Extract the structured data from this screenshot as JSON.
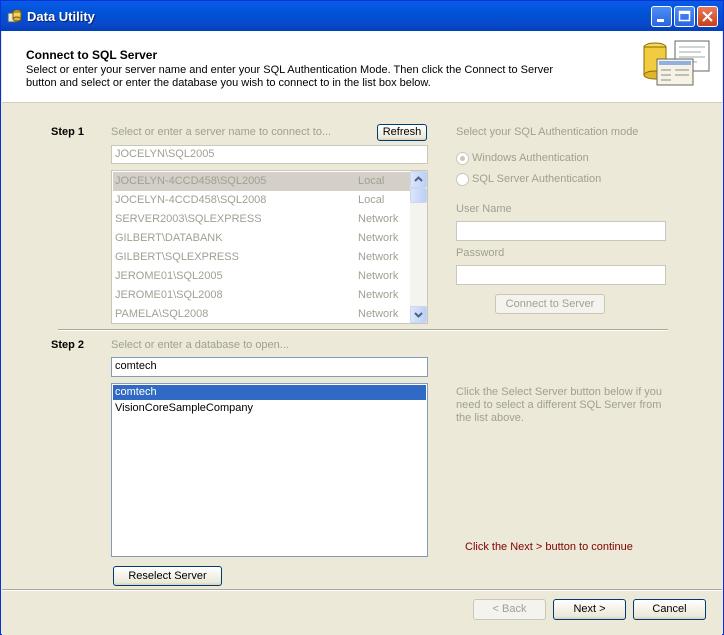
{
  "window": {
    "title": "Data Utility"
  },
  "header": {
    "title": "Connect to SQL Server",
    "description": "Select or enter your server name and enter your SQL Authentication Mode.  Then click the Connect to Server button and select or enter the database you wish to connect to in the list box below."
  },
  "step1": {
    "label": "Step 1",
    "prompt": "Select or enter a server name to connect to...",
    "refresh_label": "Refresh",
    "server_value": "JOCELYN\\SQL2005",
    "servers": [
      {
        "name": "JOCELYN-4CCD458\\SQL2005",
        "type": "Local"
      },
      {
        "name": "JOCELYN-4CCD458\\SQL2008",
        "type": "Local"
      },
      {
        "name": "SERVER2003\\SQLEXPRESS",
        "type": "Network"
      },
      {
        "name": "GILBERT\\DATABANK",
        "type": "Network"
      },
      {
        "name": "GILBERT\\SQLEXPRESS",
        "type": "Network"
      },
      {
        "name": "JEROME01\\SQL2005",
        "type": "Network"
      },
      {
        "name": "JEROME01\\SQL2008",
        "type": "Network"
      },
      {
        "name": "PAMELA\\SQL2008",
        "type": "Network"
      }
    ]
  },
  "auth": {
    "prompt": "Select your SQL Authentication mode",
    "windows_label": "Windows Authentication",
    "sql_label": "SQL Server Authentication",
    "username_label": "User Name",
    "password_label": "Password",
    "connect_label": "Connect to Server"
  },
  "step2": {
    "label": "Step 2",
    "prompt": "Select or enter a database to open...",
    "db_value": "comtech",
    "databases": [
      "comtech",
      "VisionCoreSampleCompany"
    ],
    "reselect_label": "Reselect Server",
    "hint": "Click the Select Server button below if you need to select a different SQL Server from the list above.",
    "next_hint": "Click the Next > button to continue"
  },
  "footer": {
    "back_label": "< Back",
    "next_label": "Next >",
    "cancel_label": "Cancel"
  },
  "colors": {
    "accent": "#316ac5",
    "hint_red": "#800000",
    "title_blue": "#0052d6"
  }
}
